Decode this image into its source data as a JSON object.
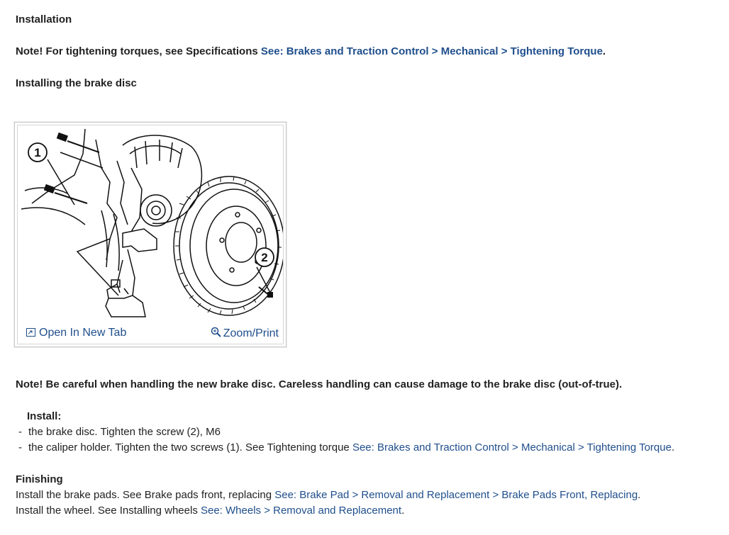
{
  "heading": "Installation",
  "note1": {
    "text": "Note! For tightening torques, see Specifications ",
    "link": "See: Brakes and Traction Control > Mechanical > Tightening Torque",
    "suffix": "."
  },
  "subheading": "Installing the brake disc",
  "figure": {
    "callout_1": "1",
    "callout_2": "2",
    "open_tab_label": "Open In New Tab",
    "zoom_label": "Zoom/Print",
    "open_tab_icon": "open-in-new-tab-icon",
    "zoom_icon": "magnifier-icon"
  },
  "note2": "Note! Be careful when handling the new brake disc. Careless handling can cause damage to the brake disc (out-of-true).",
  "install": {
    "label": "Install:",
    "dash": "-",
    "item1": "the brake disc. Tighten the screw (2), M6",
    "item2_text": "the caliper holder. Tighten the two screws (1). See Tightening torque ",
    "item2_link": "See: Brakes and Traction Control > Mechanical > Tightening Torque",
    "item2_suffix": "."
  },
  "finishing": {
    "heading": "Finishing",
    "line1_text": "Install the brake pads. See Brake pads front, replacing ",
    "line1_link": "See: Brake Pad > Removal and Replacement > Brake Pads Front, Replacing",
    "line1_suffix": ".",
    "line2_text": "Install the wheel. See Installing wheels ",
    "line2_link": "See: Wheels > Removal and Replacement",
    "line2_suffix": "."
  }
}
